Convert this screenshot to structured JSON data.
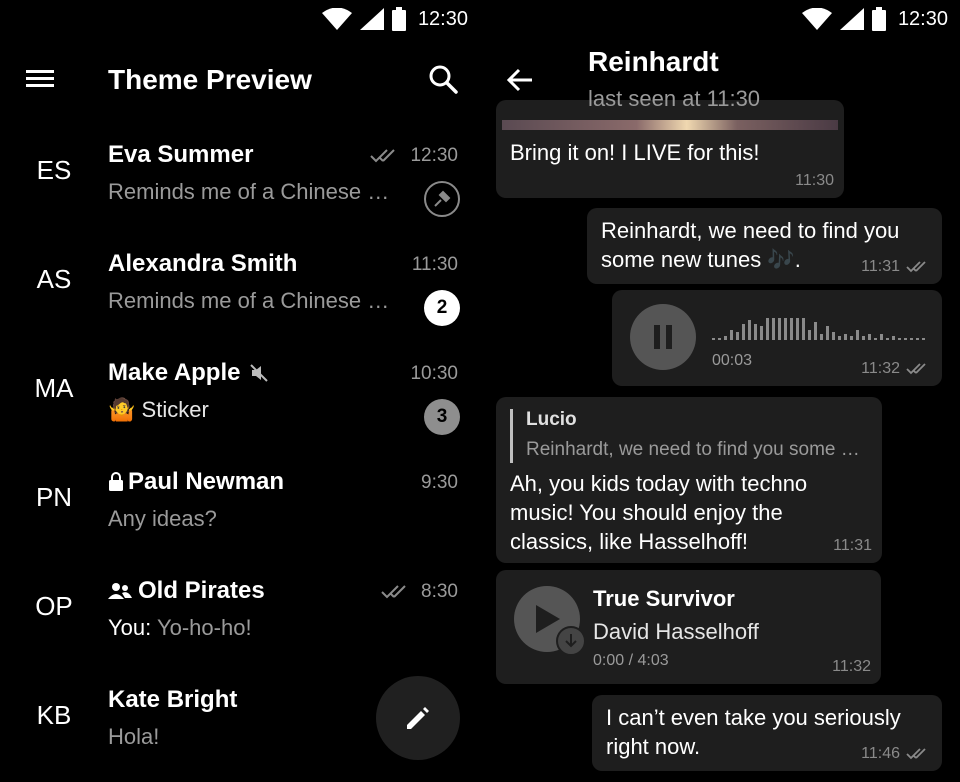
{
  "status": {
    "time": "12:30"
  },
  "list": {
    "title": "Theme Preview",
    "chats": [
      {
        "initials": "ES",
        "name": "Eva Summer",
        "message": "Reminds me of a Chinese prison",
        "time": "12:30",
        "read": true,
        "pinned": true
      },
      {
        "initials": "AS",
        "name": "Alexandra Smith",
        "message": "Reminds me of a Chinese prison",
        "time": "11:30",
        "unread": "2"
      },
      {
        "initials": "MA",
        "name": "Make Apple",
        "message_emoji": "🤷",
        "message": "Sticker",
        "time": "10:30",
        "unread": "3",
        "muted": true
      },
      {
        "initials": "PN",
        "name": "Paul Newman",
        "message": "Any ideas?",
        "time": "9:30",
        "secret": true
      },
      {
        "initials": "OP",
        "name": "Old Pirates",
        "message_prefix": "You:",
        "message": "Yo-ho-ho!",
        "time": "8:30",
        "read": true,
        "group": true
      },
      {
        "initials": "KB",
        "name": "Kate Bright",
        "message": "Hola!",
        "time": ""
      }
    ]
  },
  "chat": {
    "name": "Reinhardt",
    "subtitle": "last seen at 11:30",
    "messages": {
      "m1": {
        "text": "Bring it on! I LIVE for this!",
        "time": "11:30"
      },
      "m2": {
        "text_a": "Reinhardt, we need to find you",
        "text_b": "some new tunes",
        "emoji": "🎶",
        "text_c": ".",
        "time": "11:31"
      },
      "m3": {
        "duration": "00:03",
        "time": "11:32"
      },
      "m4": {
        "reply_name": "Lucio",
        "reply_text": "Reinhardt, we need to find you some new tunes",
        "line1": "Ah, you kids today with techno",
        "line2": "music! You should enjoy the",
        "line3": "classics, like Hasselhoff!",
        "time": "11:31"
      },
      "m5": {
        "title": "True Survivor",
        "artist": "David Hasselhoff",
        "progress": "0:00 / 4:03",
        "time": "11:32"
      },
      "m6": {
        "line1": "I can’t even take you seriously",
        "line2": "right now.",
        "time": "11:46"
      }
    }
  },
  "icons": {
    "menu": "menu-icon",
    "search": "search-icon",
    "back": "arrow-back-icon",
    "pencil": "pencil-icon",
    "pause": "pause-icon",
    "play": "play-icon",
    "download": "download-icon",
    "double_check": "double-check-icon",
    "pin": "pin-icon",
    "mute": "mute-icon",
    "lock": "lock-icon",
    "group": "group-icon"
  },
  "colors": {
    "background": "#000000",
    "bubble": "#1e1e1e",
    "secondary_text": "#9a9a9a"
  }
}
